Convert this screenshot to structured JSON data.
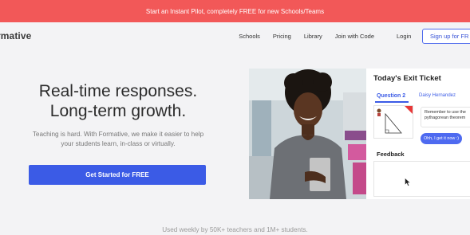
{
  "banner": {
    "text": "Start an Instant Pilot, completely FREE for new Schools/Teams"
  },
  "nav": {
    "logo": "rmative",
    "links": [
      "Schools",
      "Pricing",
      "Library",
      "Join with Code"
    ],
    "login": "Login",
    "signup": "Sign up for FR"
  },
  "hero": {
    "title_line1": "Real-time responses.",
    "title_line2": "Long-term growth.",
    "sub_line1": "Teaching is hard. With Formative, we make it easier to help",
    "sub_line2": "your students learn, in-class or virtually.",
    "cta": "Get Started for FREE"
  },
  "ticket": {
    "title": "Today's Exit Ticket",
    "question_tab": "Question 2",
    "student_name": "Daisy Hernandez",
    "bubble_remember": "Remember to use the pythagorean theorem",
    "bubble_ok": "Ohh, I get it now :)",
    "feedback_label": "Feedback"
  },
  "footer": {
    "text": "Used weekly by 50K+ teachers and 1M+ students."
  },
  "colors": {
    "banner": "#f25858",
    "accent": "#3b5be6",
    "background": "#f3f3f5"
  }
}
